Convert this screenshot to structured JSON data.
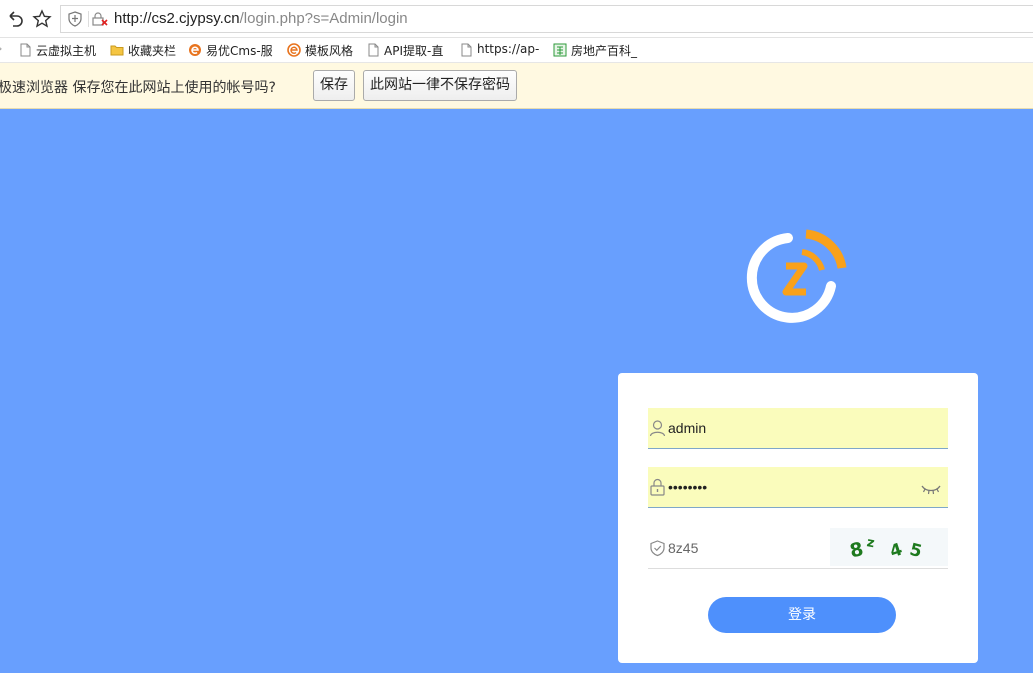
{
  "browser": {
    "url_host": "http://cs2.cjypsy.cn",
    "url_path": "/login.php?s=Admin/login"
  },
  "bookmarks": [
    {
      "label": "云虚拟主机",
      "icon": "page-icon"
    },
    {
      "label": "收藏夹栏",
      "icon": "folder-icon"
    },
    {
      "label": "易优Cms-服",
      "icon": "eyou-logo-icon"
    },
    {
      "label": "模板风格",
      "icon": "eyou-logo-icon"
    },
    {
      "label": "API提取-直",
      "icon": "page-icon"
    },
    {
      "label": "https://ap-",
      "icon": "page-icon"
    },
    {
      "label": "房地产百科_",
      "icon": "building-icon"
    }
  ],
  "infobar": {
    "message": "极速浏览器 保存您在此网站上使用的帐号吗?",
    "save_label": "保存",
    "never_label": "此网站一律不保存密码"
  },
  "login": {
    "username": "admin",
    "password_mask": "••••••••",
    "captcha_value": "8z45",
    "captcha_image_text": "8z 45",
    "submit_label": "登录"
  },
  "colors": {
    "page_background": "#689ffe",
    "logo_orange": "#f9a11b",
    "submit_blue": "#4e90fc",
    "autofill_yellow": "#fafcbc",
    "captcha_green": "#1e7a1e"
  }
}
